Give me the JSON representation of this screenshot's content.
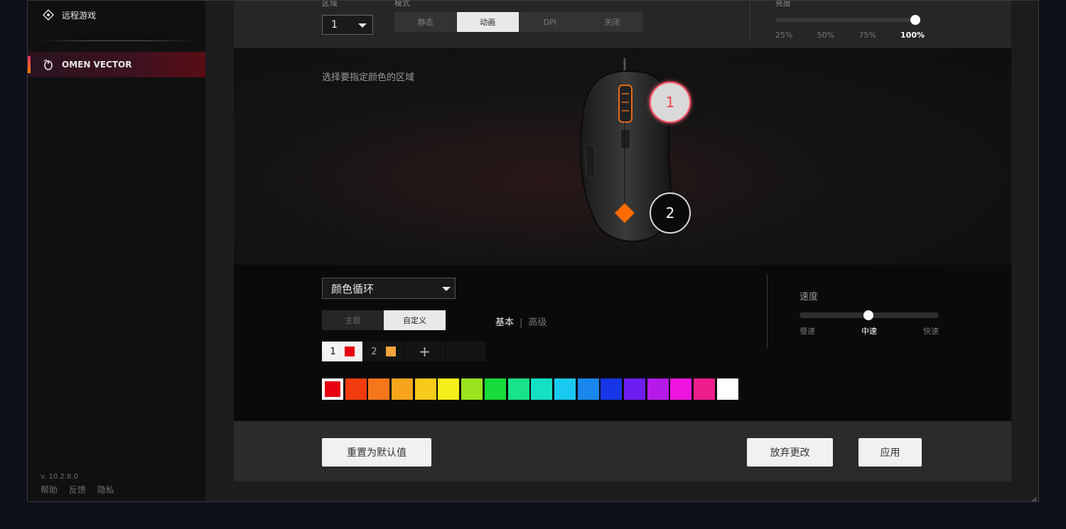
{
  "sidebar": {
    "remote_play_label": "远程游戏",
    "active_device_label": "OMEN VECTOR",
    "version": "v. 10.2.8.0",
    "links": [
      "帮助",
      "反馈",
      "隐私"
    ]
  },
  "top_bar": {
    "zone_label": "区域",
    "zone_value": "1",
    "mode_label": "模式",
    "mode_tabs": [
      "静态",
      "动画",
      "DPI",
      "关闭"
    ],
    "mode_active": "动画",
    "brightness_label": "亮度",
    "brightness_levels": [
      "25%",
      "50%",
      "75%",
      "100%"
    ],
    "brightness_value": "100%"
  },
  "preview": {
    "hint": "选择要指定颜色的区域",
    "zones": [
      "1",
      "2"
    ],
    "selected_zone": "1"
  },
  "controls": {
    "effect_value": "颜色循环",
    "theme_tabs": [
      "主题",
      "自定义"
    ],
    "theme_active": "自定义",
    "basic_label": "基本",
    "separator": "|",
    "advanced_label": "高级",
    "color_slots": [
      {
        "index": "1",
        "color": "#e60012"
      },
      {
        "index": "2",
        "color": "#f5a33a"
      }
    ],
    "add_symbol": "+",
    "palette": [
      "#e60012",
      "#f23b0f",
      "#f6761b",
      "#f9a51c",
      "#f7c91a",
      "#f5ee18",
      "#9be31e",
      "#17dc3b",
      "#19e38a",
      "#14e0c4",
      "#19c9f0",
      "#1a86ee",
      "#1736e8",
      "#6d1df0",
      "#b61ae8",
      "#ee16de",
      "#f01e8c",
      "#ffffff"
    ],
    "palette_selected": "#e60012",
    "speed_label": "速度",
    "speed_levels": [
      "慢速",
      "中速",
      "快速"
    ],
    "speed_value": "中速"
  },
  "bottom_bar": {
    "reset_label": "重置为默认值",
    "discard_label": "放弃更改",
    "apply_label": "应用"
  },
  "colors": {
    "accent": "#e3306b",
    "omen_logo": "#ff6b00"
  }
}
